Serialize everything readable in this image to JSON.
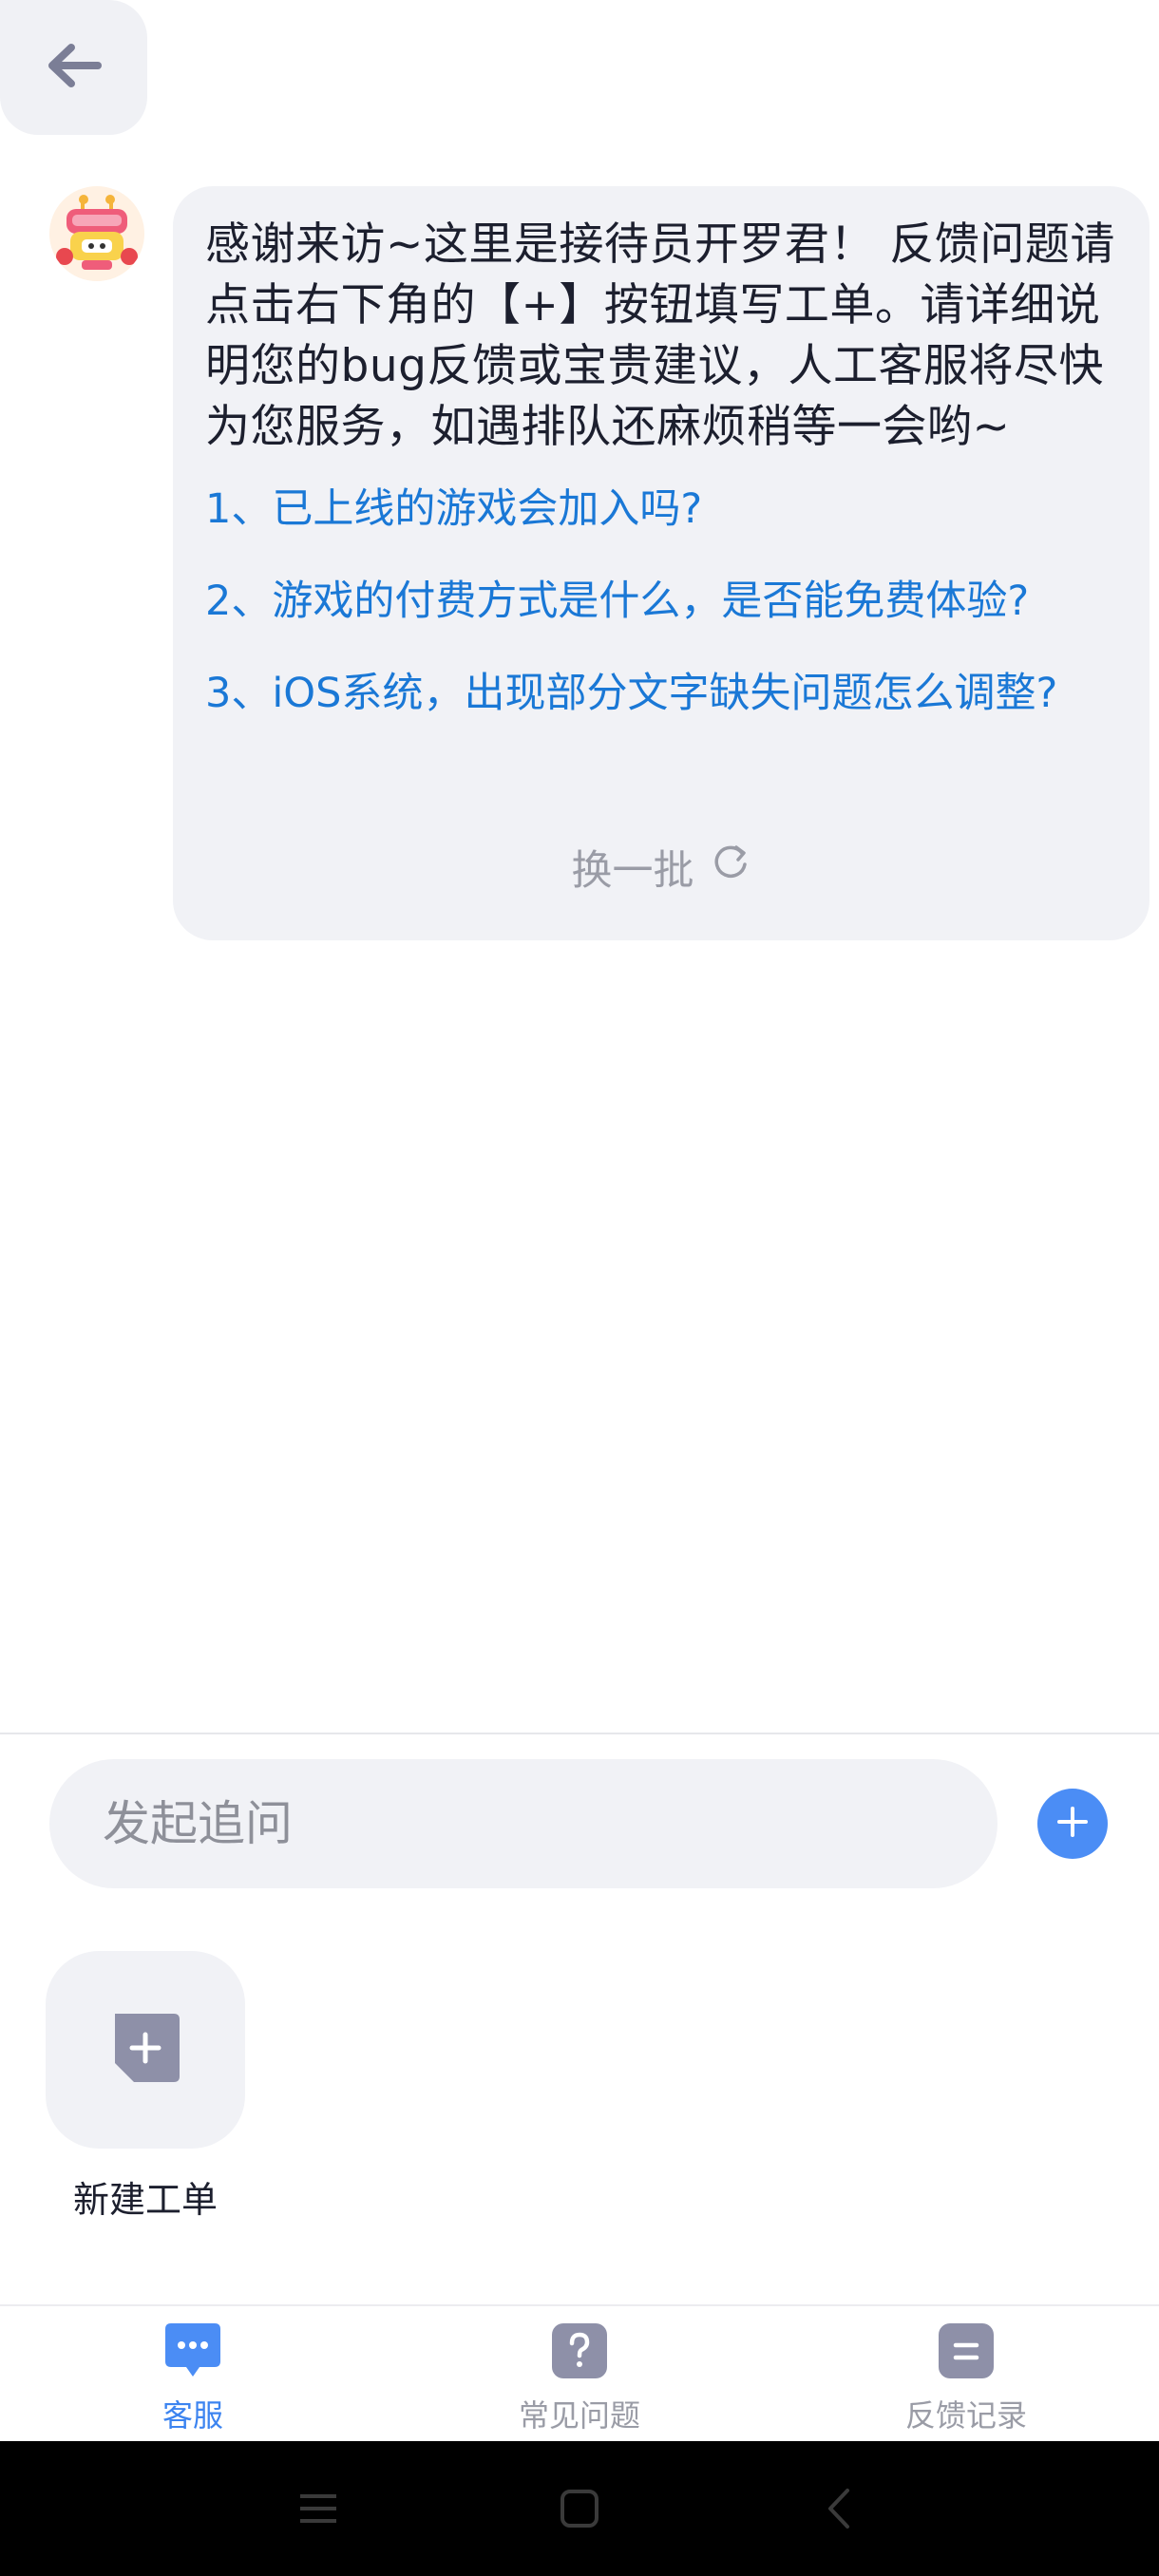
{
  "header": {
    "back_icon": "arrow-left-icon"
  },
  "chat": {
    "avatar_icon": "robot-mascot-avatar",
    "message": "感谢来访~这里是接待员开罗君！ 反馈问题请点击右下角的【+】按钮填写工单。请详细说明您的bug反馈或宝贵建议，人工客服将尽快为您服务，如遇排队还麻烦稍等一会哟~",
    "faq": [
      "1、已上线的游戏会加入吗?",
      "2、游戏的付费方式是什么，是否能免费体验?",
      "3、iOS系统，出现部分文字缺失问题怎么调整?"
    ],
    "refresh_label": "换一批",
    "link_color": "#1a78d6"
  },
  "input": {
    "placeholder": "发起追问",
    "value": ""
  },
  "tools": {
    "new_ticket_label": "新建工单"
  },
  "tabs": [
    {
      "label": "客服",
      "icon": "chat-bubble-icon",
      "active": true
    },
    {
      "label": "常见问题",
      "icon": "question-icon",
      "active": false
    },
    {
      "label": "反馈记录",
      "icon": "records-icon",
      "active": false
    }
  ],
  "colors": {
    "accent": "#4b8df5",
    "bubble_bg": "#f1f2f6",
    "icon_gray": "#8e90a8"
  }
}
